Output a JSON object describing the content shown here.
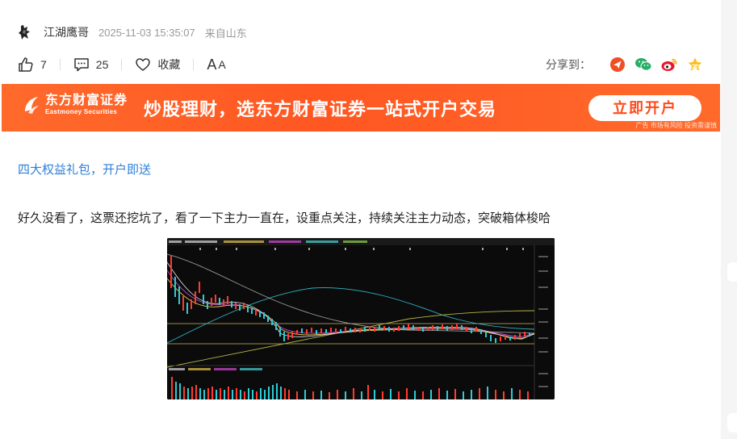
{
  "author": {
    "name": "江湖鹰哥",
    "time": "2025-11-03 15:35:07",
    "location": "来自山东"
  },
  "actions": {
    "like_count": "7",
    "comment_count": "25",
    "favorite_label": "收藏",
    "font_label_big": "A",
    "font_label_small": "A",
    "share_label": "分享到："
  },
  "share_icons": [
    "toutiao-icon",
    "wechat-icon",
    "weibo-icon",
    "qzone-icon"
  ],
  "banner": {
    "logo_cn": "东方财富证券",
    "logo_en": "Eastmoney Securities",
    "slogan": "炒股理财，选东方财富证券一站式开户交易",
    "button_label": "立即开户",
    "ad_note": "广告 市场有风险 投资需谨慎"
  },
  "post": {
    "promo_link": "四大权益礼包，开户即送",
    "text": "好久没看了，这票还挖坑了，看了一下主力一直在，设重点关注，持续关注主力动态，突破箱体梭哈"
  },
  "colors": {
    "banner_orange": "#ff5722",
    "link_blue": "#2e7fd7",
    "button_text": "#ff4a1a"
  }
}
